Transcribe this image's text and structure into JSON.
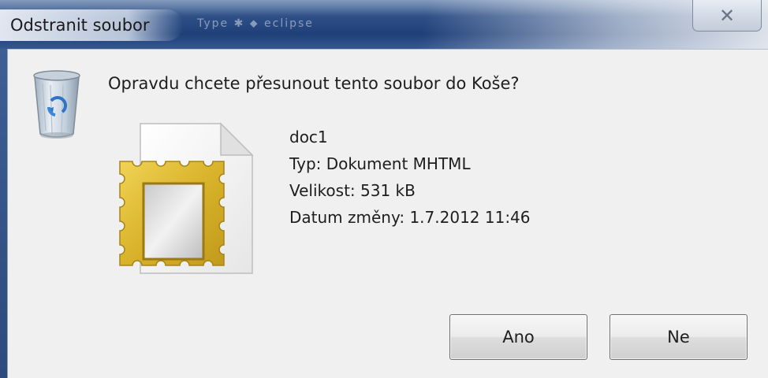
{
  "window": {
    "title": "Odstranit soubor",
    "close_glyph": "✕",
    "background_hint": "Type ✱ ⬥ eclipse"
  },
  "dialog": {
    "question": "Opravdu chcete přesunout tento soubor do Koše?",
    "icons": {
      "recycle": "recycle-bin-icon",
      "file": "mhtml-document-icon"
    },
    "file": {
      "name": "doc1",
      "type": "Typ: Dokument MHTML",
      "size": "Velikost: 531 kB",
      "modified": "Datum změny: 1.7.2012 11:46"
    },
    "buttons": {
      "yes": "Ano",
      "no": "Ne"
    }
  },
  "colors": {
    "titlebar": "#2e4f86",
    "client_bg": "#f0f0f0",
    "file_frame": "#d8b52c"
  }
}
